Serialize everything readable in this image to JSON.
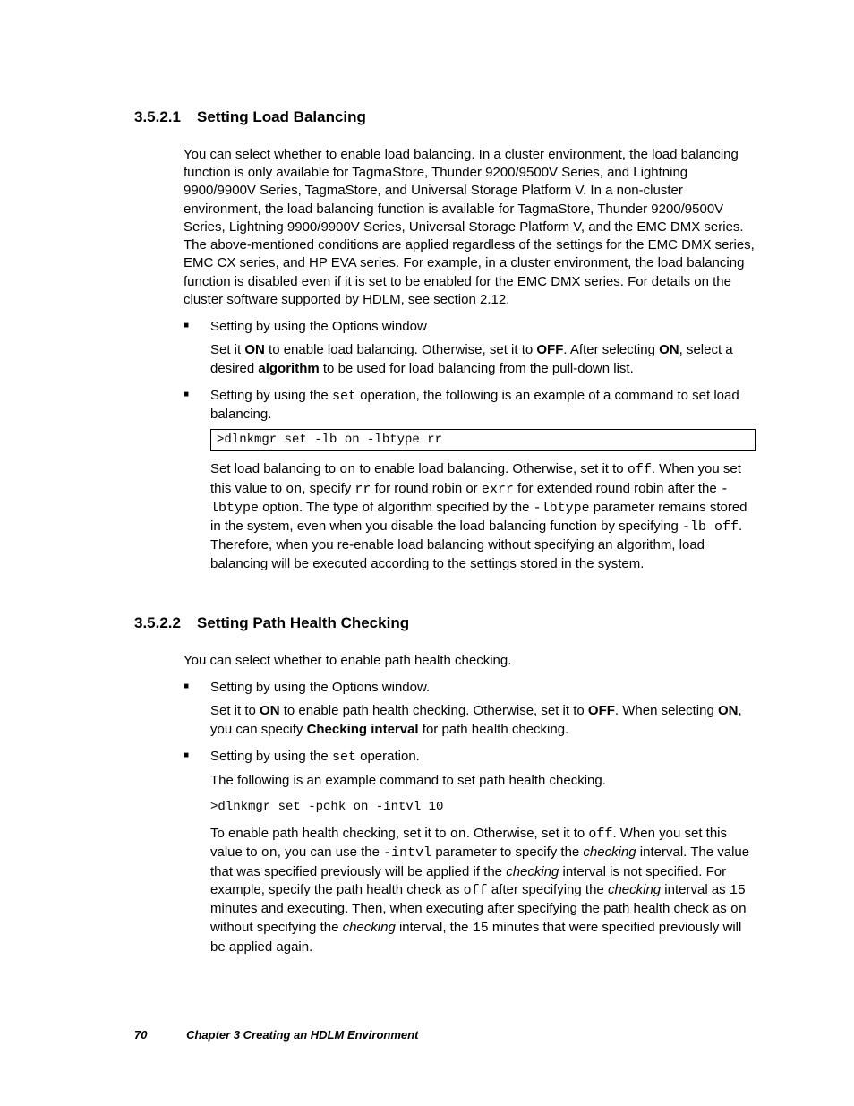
{
  "sections": [
    {
      "num": "3.5.2.1",
      "title": "Setting Load Balancing",
      "intro_html": "You can select whether to enable load balancing. In a cluster environment, the load balancing function is only available for TagmaStore, Thunder 9200/9500V Series, and Lightning 9900/9900V Series, TagmaStore, and Universal Storage Platform V. In a non-cluster environment, the load balancing function is available for TagmaStore, Thunder 9200/9500V Series, Lightning 9900/9900V Series, Universal Storage Platform V, and the EMC DMX series. The above-mentioned conditions are applied regardless of the settings for the EMC DMX series, EMC CX series, and HP EVA series. For example, in a cluster environment, the load balancing function is disabled even if it is set to be enabled for the EMC DMX series. For details on the cluster software supported by HDLM, see section 2.12.",
      "bullets": [
        {
          "head_html": "Setting by using the Options window",
          "body_html": "Set it <b>ON</b> to enable load balancing. Otherwise, set it to <b>OFF</b>. After selecting <b>ON</b>, select a desired <b>algorithm</b> to be used for load balancing from the pull-down list."
        },
        {
          "head_html": "Setting by using the <span class=\"code\">set</span> operation, the following is an example of a command to set load balancing.",
          "codebox": ">dlnkmgr set -lb on -lbtype rr",
          "body_html": "Set load balancing to <span class=\"code\">on</span> to enable load balancing. Otherwise, set it to <span class=\"code\">off</span>. When you set this value to <span class=\"code\">on</span>, specify <span class=\"code\">rr</span> for round robin or <span class=\"code\">exrr</span> for extended round robin after the <span class=\"code\">-lbtype</span> option. The type of algorithm specified by the <span class=\"code\">-lbtype</span> parameter remains stored in the system, even when you disable the load balancing function by specifying <span class=\"code\">-lb off</span>. Therefore, when you re-enable load balancing without specifying an algorithm, load balancing will be executed according to the settings stored in the system."
        }
      ]
    },
    {
      "num": "3.5.2.2",
      "title": "Setting Path Health Checking",
      "intro_html": "You can select whether to enable path health checking.",
      "bullets": [
        {
          "head_html": "Setting by using the Options window.",
          "body_html": "Set it to <b>ON</b> to enable path health checking. Otherwise, set it to <b>OFF</b>. When selecting <b>ON</b>, you can specify <b>Checking interval</b> for path health checking."
        },
        {
          "head_html": "Setting by using the <span class=\"code\">set</span> operation.",
          "pre_body_html": "The following is an example command to set path health checking.",
          "codeline": ">dlnkmgr set -pchk on -intvl 10",
          "body_html": "To enable path health checking, set it to <span class=\"code\">on</span>. Otherwise, set it to <span class=\"code\">off</span>. When you set this value to <span class=\"code\">on</span>, you can use the <span class=\"code\">-intvl</span> parameter to specify the <i>checking</i> interval. The value that was specified previously will be applied if the <i>checking</i> interval is not specified. For example, specify the path health check as <span class=\"code\">off</span> after specifying the <i>checking</i> interval as <span class=\"code\">15</span> minutes and executing. Then, when executing after specifying the path health check as <span class=\"code\">on</span> without specifying the <i>checking</i> interval, the <span class=\"code\">15</span> minutes that were specified previously will be applied again."
        }
      ]
    }
  ],
  "footer": {
    "page": "70",
    "chapter": "Chapter 3   Creating an HDLM Environment"
  }
}
